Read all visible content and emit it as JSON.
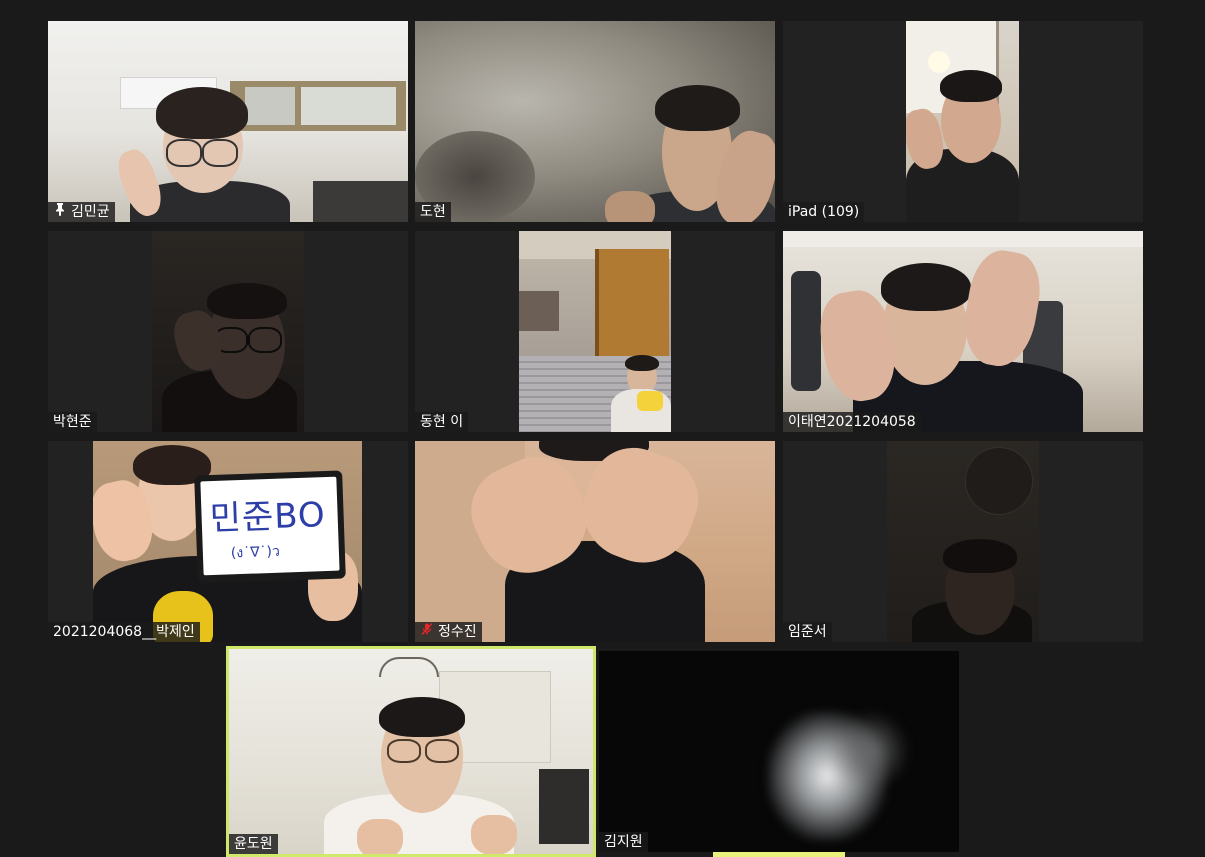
{
  "participants": [
    {
      "name": "김민균",
      "pinned": true,
      "muted": false
    },
    {
      "name": "도현",
      "pinned": false,
      "muted": false
    },
    {
      "name": "iPad (109)",
      "pinned": false,
      "muted": false
    },
    {
      "name": "박현준",
      "pinned": false,
      "muted": false
    },
    {
      "name": "동현 이",
      "pinned": false,
      "muted": false
    },
    {
      "name": "이태연2021204058",
      "pinned": false,
      "muted": false
    },
    {
      "name": "2021204068__박제인",
      "pinned": false,
      "muted": false
    },
    {
      "name": "정수진",
      "pinned": false,
      "muted": true
    },
    {
      "name": "임준서",
      "pinned": false,
      "muted": false
    },
    {
      "name": "윤도원",
      "pinned": false,
      "muted": false,
      "active_speaker": true
    },
    {
      "name": "김지원",
      "pinned": false,
      "muted": false
    }
  ],
  "tablet_sign": {
    "line1": "민준BO",
    "line2": "(ง˙∇˙)ว"
  },
  "icons": {
    "pin": "pin-icon",
    "muted": "muted-microphone-icon"
  },
  "colors": {
    "background": "#1a1a1a",
    "tile_background": "#222222",
    "active_speaker_border": "#cfe86b",
    "muted_icon": "#e02828"
  }
}
